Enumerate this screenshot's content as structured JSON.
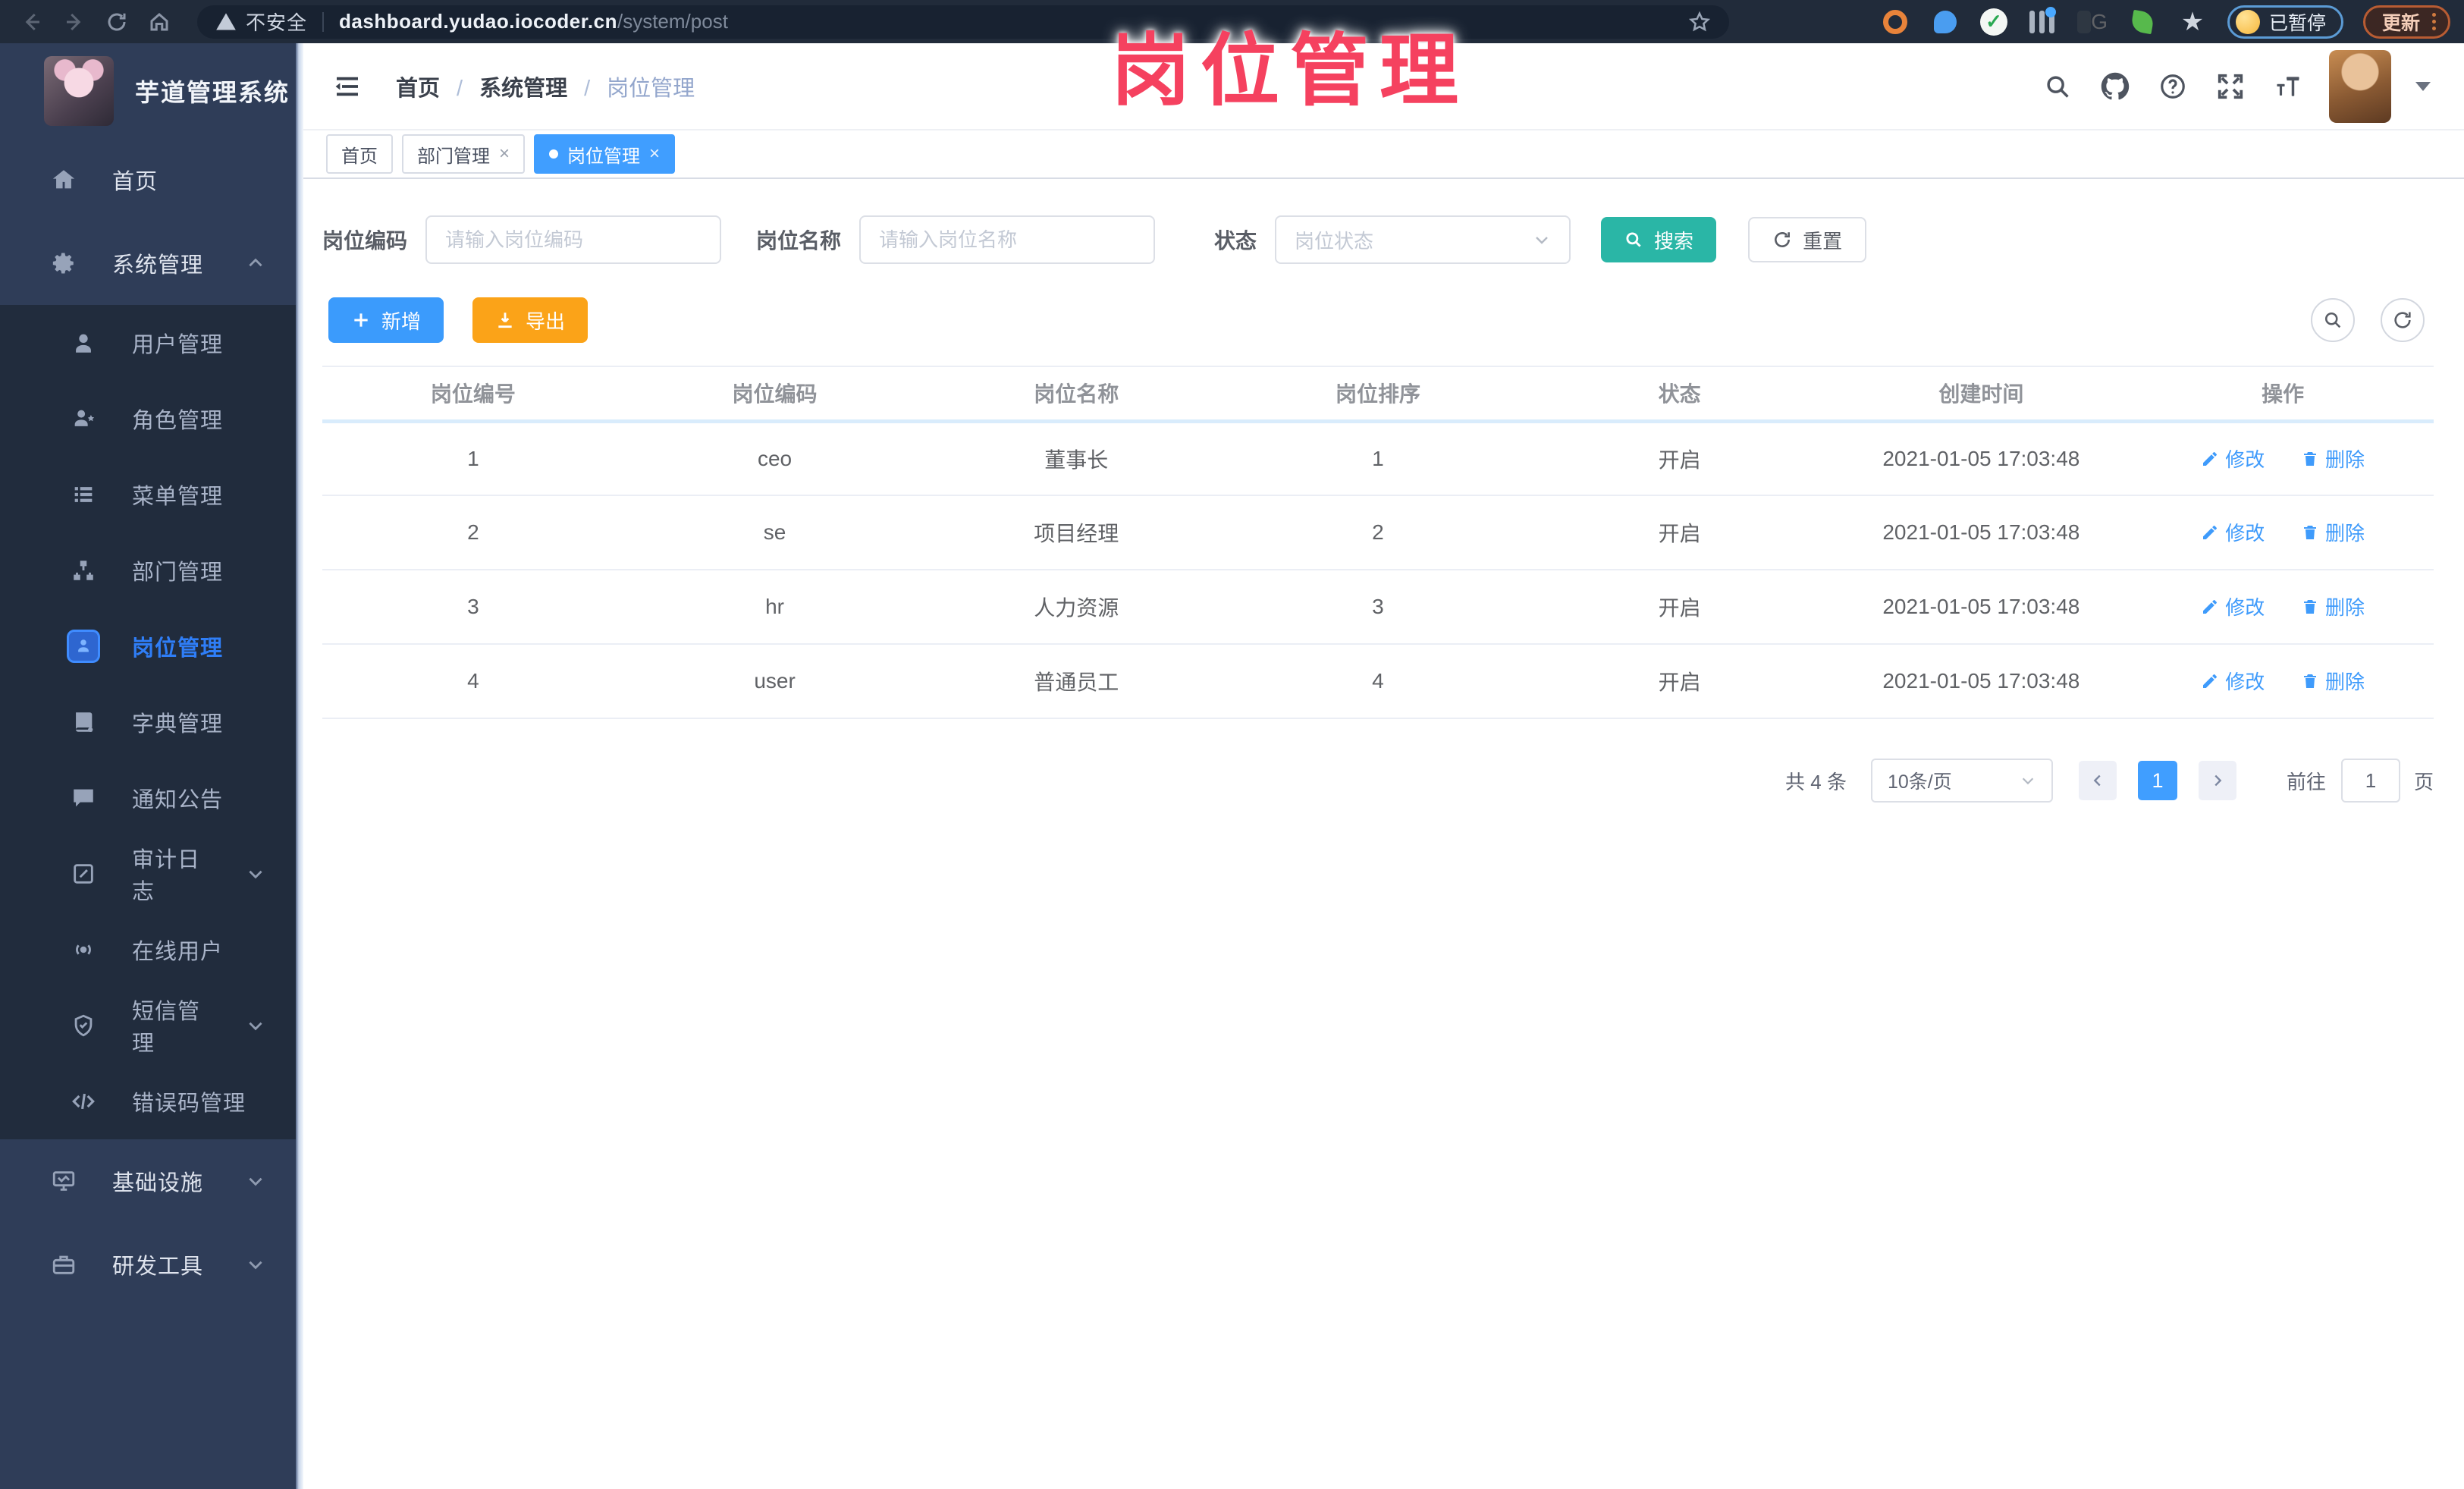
{
  "browser": {
    "security_label": "不安全",
    "url_host": "dashboard.yudao.iocoder.cn",
    "url_path": "/system/post",
    "paused_label": "已暂停",
    "update_label": "更新",
    "extension_icons": [
      "orange-ring-icon",
      "location-pin-icon",
      "green-check-icon",
      "sliders-icon",
      "dark-card-icon",
      "sprout-icon",
      "puzzle-icon"
    ]
  },
  "watermark": {
    "text": "岗位管理",
    "color": "#f5415f"
  },
  "sidebar": {
    "title": "芋道管理系统",
    "menu": [
      {
        "label": "首页",
        "icon": "home-icon"
      },
      {
        "label": "系统管理",
        "icon": "gear-icon",
        "chevron": "up"
      },
      {
        "label": "用户管理",
        "icon": "user-icon"
      },
      {
        "label": "角色管理",
        "icon": "role-icon"
      },
      {
        "label": "菜单管理",
        "icon": "menu-list-icon"
      },
      {
        "label": "部门管理",
        "icon": "org-icon"
      },
      {
        "label": "岗位管理",
        "icon": "post-badge-icon",
        "active": true
      },
      {
        "label": "字典管理",
        "icon": "dictionary-icon"
      },
      {
        "label": "通知公告",
        "icon": "announcement-icon"
      },
      {
        "label": "审计日志",
        "icon": "audit-log-icon",
        "chevron": "down"
      },
      {
        "label": "在线用户",
        "icon": "online-user-icon"
      },
      {
        "label": "短信管理",
        "icon": "sms-shield-icon",
        "chevron": "down"
      },
      {
        "label": "错误码管理",
        "icon": "code-icon"
      },
      {
        "label": "基础设施",
        "icon": "infrastructure-icon",
        "chevron": "down"
      },
      {
        "label": "研发工具",
        "icon": "dev-tools-icon",
        "chevron": "down"
      }
    ]
  },
  "header": {
    "breadcrumb": [
      "首页",
      "系统管理",
      "岗位管理"
    ]
  },
  "tabs": [
    {
      "label": "首页"
    },
    {
      "label": "部门管理",
      "closable": true
    },
    {
      "label": "岗位管理",
      "closable": true,
      "active": true
    }
  ],
  "filters": {
    "post_code_label": "岗位编码",
    "post_code_placeholder": "请输入岗位编码",
    "post_name_label": "岗位名称",
    "post_name_placeholder": "请输入岗位名称",
    "status_label": "状态",
    "status_placeholder": "岗位状态",
    "search_label": "搜索",
    "reset_label": "重置"
  },
  "toolbar": {
    "add_label": "新增",
    "export_label": "导出"
  },
  "table": {
    "columns": [
      "岗位编号",
      "岗位编码",
      "岗位名称",
      "岗位排序",
      "状态",
      "创建时间",
      "操作"
    ],
    "edit_label": "修改",
    "delete_label": "删除",
    "rows": [
      {
        "id": "1",
        "code": "ceo",
        "name": "董事长",
        "sort": "1",
        "status": "开启",
        "created": "2021-01-05 17:03:48"
      },
      {
        "id": "2",
        "code": "se",
        "name": "项目经理",
        "sort": "2",
        "status": "开启",
        "created": "2021-01-05 17:03:48"
      },
      {
        "id": "3",
        "code": "hr",
        "name": "人力资源",
        "sort": "3",
        "status": "开启",
        "created": "2021-01-05 17:03:48"
      },
      {
        "id": "4",
        "code": "user",
        "name": "普通员工",
        "sort": "4",
        "status": "开启",
        "created": "2021-01-05 17:03:48"
      }
    ]
  },
  "pagination": {
    "total_text": "共 4 条",
    "page_size": "10条/页",
    "current_page": "1",
    "goto_label": "前往",
    "goto_value": "1",
    "page_unit": "页"
  }
}
